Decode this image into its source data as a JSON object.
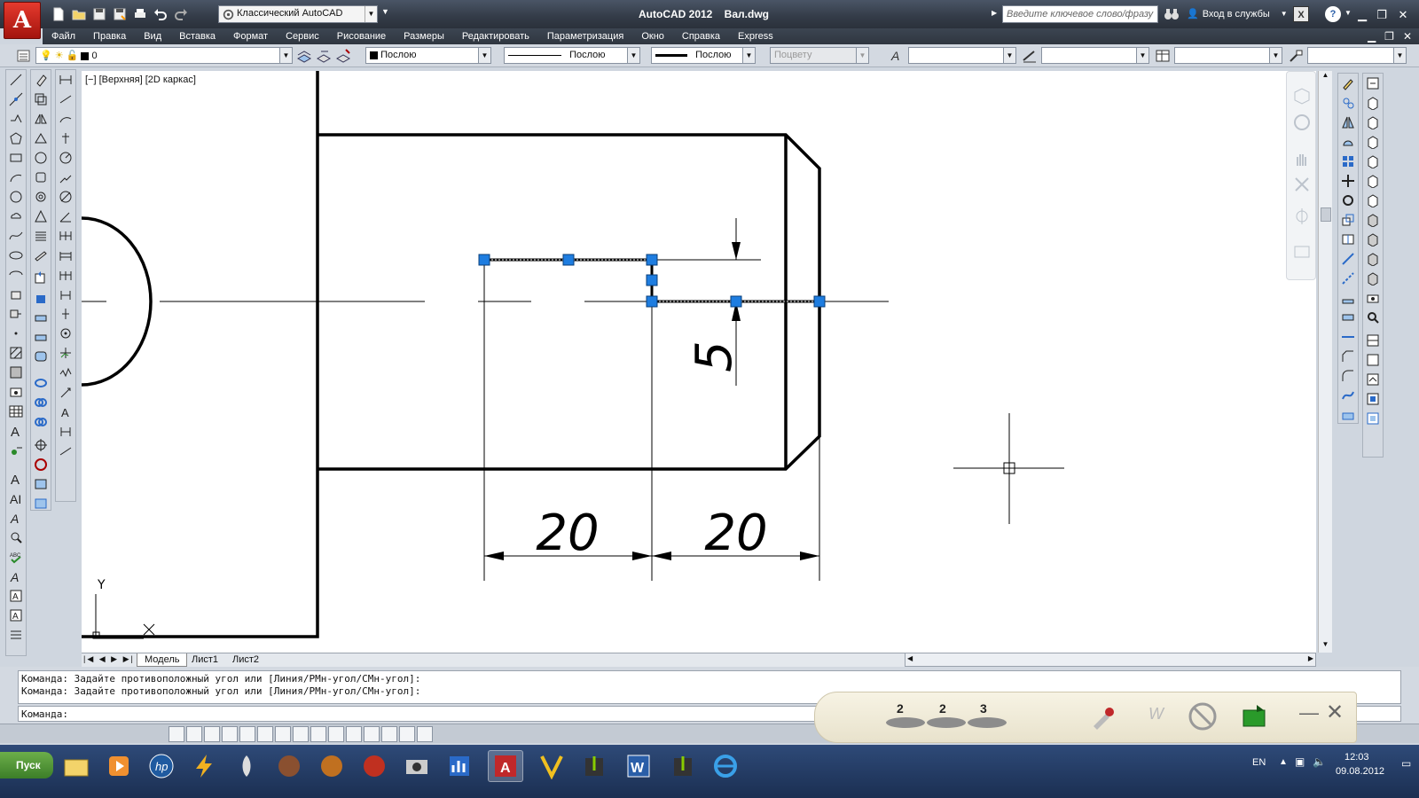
{
  "app": {
    "logo_letter": "A",
    "title": "AutoCAD 2012    Вал.dwg",
    "workspace": "Классический AutoCAD",
    "search_placeholder": "Введите ключевое слово/фразу",
    "signin_label": "Вход в службы"
  },
  "menu": [
    "Файл",
    "Правка",
    "Вид",
    "Вставка",
    "Формат",
    "Сервис",
    "Рисование",
    "Размеры",
    "Редактировать",
    "Параметризация",
    "Окно",
    "Справка",
    "Express"
  ],
  "properties": {
    "layer": "0",
    "color": "Послою",
    "linetype": "Послою",
    "lineweight": "Послою",
    "plotstyle": "Поцвету"
  },
  "viewport": {
    "label": "[−] [Верхняя] [2D каркас]"
  },
  "drawing": {
    "dim1": "20",
    "dim2": "20",
    "dim3": "5",
    "ucs_y": "Y",
    "ucs_x": "X"
  },
  "tabs": [
    "Модель",
    "Лист1",
    "Лист2"
  ],
  "command": {
    "history": [
      "Команда: Задайте противоположный угол или [Линия/РМн-угол/СМн-угол]:",
      "Команда: Задайте противоположный угол или [Линия/РМн-угол/СМн-угол]:"
    ],
    "prompt": "Команда:"
  },
  "widget": {
    "n1": "2",
    "n2": "2",
    "n3": "3"
  },
  "taskbar": {
    "start": "Пуск",
    "lang": "EN",
    "time": "12:03",
    "date": "09.08.2012"
  },
  "colors": {
    "accent": "#1e7de0",
    "title_bg": "#333b47",
    "grip": "#1e7de0"
  }
}
